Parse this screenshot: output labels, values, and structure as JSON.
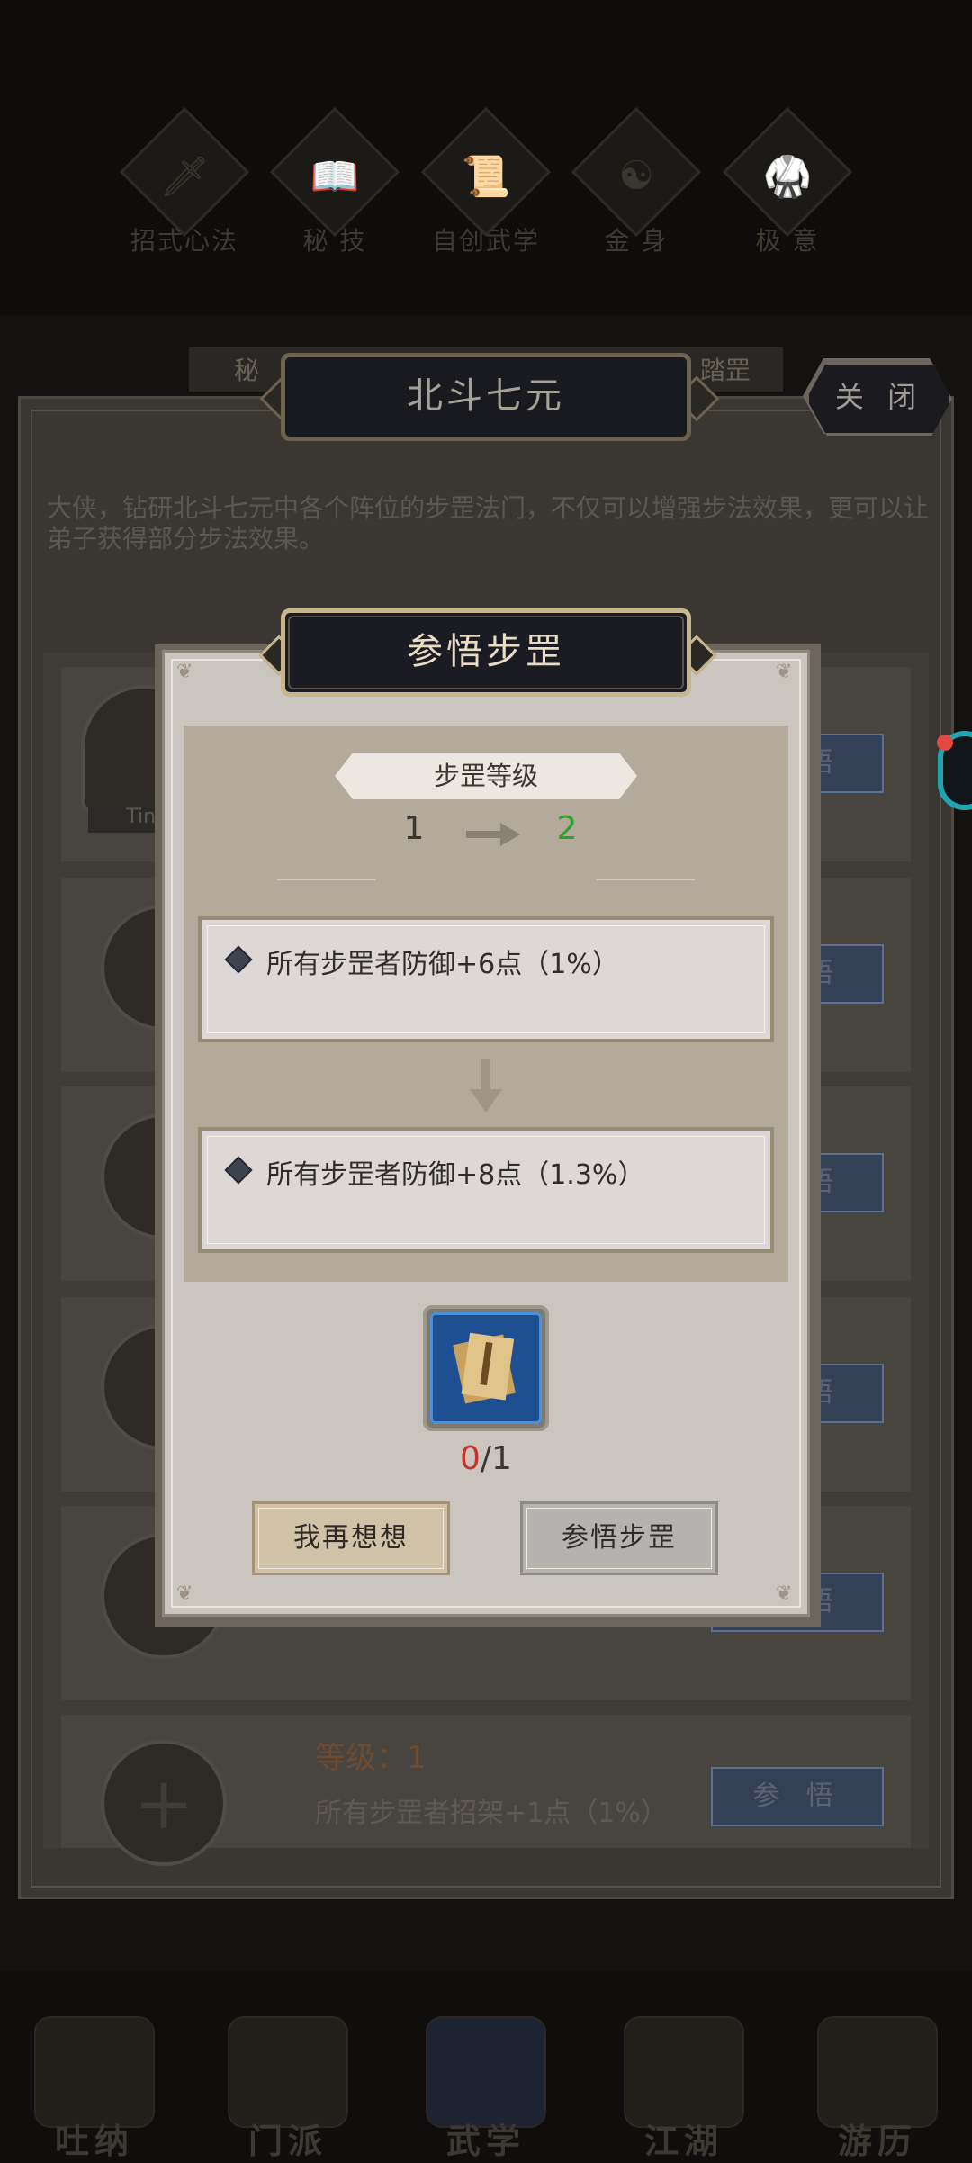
{
  "top_nav": {
    "items": [
      {
        "label": "招式心法",
        "icon": "sword-icon"
      },
      {
        "label": "秘 技",
        "icon": "book-icon"
      },
      {
        "label": "自创武学",
        "icon": "scroll-icon"
      },
      {
        "label": "金 身",
        "icon": "meditation-icon"
      },
      {
        "label": "极 意",
        "icon": "martial-pose-icon"
      }
    ]
  },
  "background_panel": {
    "tab_left": "秘",
    "tab_right": "踏罡",
    "title": "北斗七元",
    "close_label": "关 闭",
    "description": "大侠，钻研北斗七元中各个阵位的步罡法门，不仅可以增强步法效果，更可以让弟子获得部分步法效果。",
    "first_card_name": "Tink",
    "action_label": "参 悟",
    "last_card": {
      "level_label": "等级：1",
      "effect": "所有步罡者招架+1点（1%）",
      "action_label": "参 悟"
    }
  },
  "modal": {
    "title": "参悟步罡",
    "level_label": "步罡等级",
    "level_from": "1",
    "level_to": "2",
    "current_effect": "所有步罡者防御+6点（1%）",
    "next_effect": "所有步罡者防御+8点（1.3%）",
    "cost_have": "0",
    "cost_need": "/1",
    "cancel_label": "我再想想",
    "confirm_label": "参悟步罡"
  },
  "bottom_nav": {
    "items": [
      {
        "label": "吐纳"
      },
      {
        "label": "门派"
      },
      {
        "label": "武学"
      },
      {
        "label": "江湖"
      },
      {
        "label": "游历"
      }
    ]
  },
  "colors": {
    "level_up": "#2fa02a",
    "cost_insufficient": "#c5322b",
    "modal_title_gold": "#c6b58d"
  }
}
